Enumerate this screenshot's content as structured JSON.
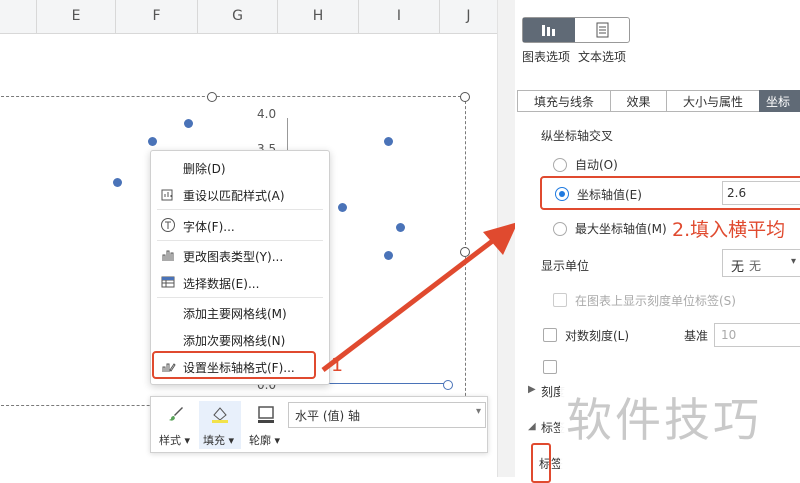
{
  "sheet": {
    "columns": [
      "E",
      "F",
      "G",
      "H",
      "I",
      "J"
    ]
  },
  "chart": {
    "axis_ticks": [
      "4.0",
      "3.5",
      "0.0"
    ]
  },
  "context_menu": {
    "items": {
      "delete": "删除(D)",
      "reset_style": "重设以匹配样式(A)",
      "font": "字体(F)...",
      "change_chart_type": "更改图表类型(Y)...",
      "select_data": "选择数据(E)...",
      "add_major_grid": "添加主要网格线(M)",
      "add_minor_grid": "添加次要网格线(N)",
      "format_axis": "设置坐标轴格式(F)..."
    }
  },
  "annotations": {
    "step1": "1",
    "step2": "2.填入横平均"
  },
  "mini_toolbar": {
    "style_label": "样式",
    "fill_label": "填充",
    "outline_label": "轮廓",
    "axis_select_value": "水平 (值) 轴"
  },
  "panel": {
    "chart_options_label": "图表选项",
    "text_options_label": "文本选项",
    "tabs": [
      "填充与线条",
      "效果",
      "大小与属性",
      "坐标"
    ],
    "section_vertical_cross": "纵坐标轴交叉",
    "radio_auto": "自动(O)",
    "radio_axis_value": "坐标轴值(E)",
    "axis_value_input": "2.6",
    "radio_max_axis_value": "最大坐标轴值(M)",
    "display_unit_label": "显示单位",
    "display_unit_value": "无",
    "display_unit_value_alt": "无",
    "show_unit_label": "在图表上显示刻度单位标签(S)",
    "log_scale_label": "对数刻度(L)",
    "base_label": "基准",
    "base_value": "10",
    "tick_section": "刻度",
    "label_section": "标签",
    "label_subsection": "标签"
  },
  "watermark": "软件技巧",
  "colors": {
    "accent_red": "#e04a2f",
    "marker_blue": "#4a73b8",
    "radio_blue": "#1f7ae0"
  }
}
